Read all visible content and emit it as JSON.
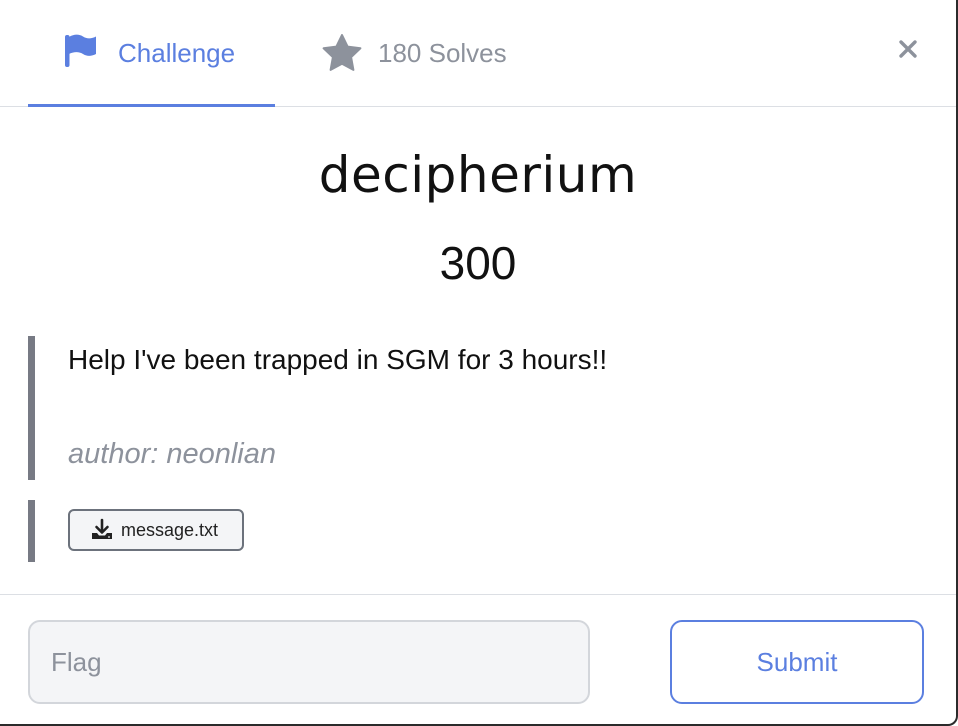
{
  "tabs": {
    "challenge": {
      "label": "Challenge",
      "icon": "flag-icon",
      "active": true
    },
    "solves": {
      "label": "180 Solves",
      "icon": "star-icon",
      "active": false
    }
  },
  "close_icon": "close-icon",
  "challenge": {
    "name": "decipherium",
    "points": "300",
    "description": "Help I've been trapped in SGM for 3 hours!!",
    "author": "author: neonlian"
  },
  "files": [
    {
      "name": "message.txt",
      "icon": "download-icon"
    }
  ],
  "form": {
    "flag_placeholder": "Flag",
    "flag_value": "",
    "submit_label": "Submit"
  },
  "colors": {
    "accent": "#5b7fe0",
    "muted": "#8d929c",
    "border": "#dcdfe4",
    "quote_bar": "#777a84"
  }
}
